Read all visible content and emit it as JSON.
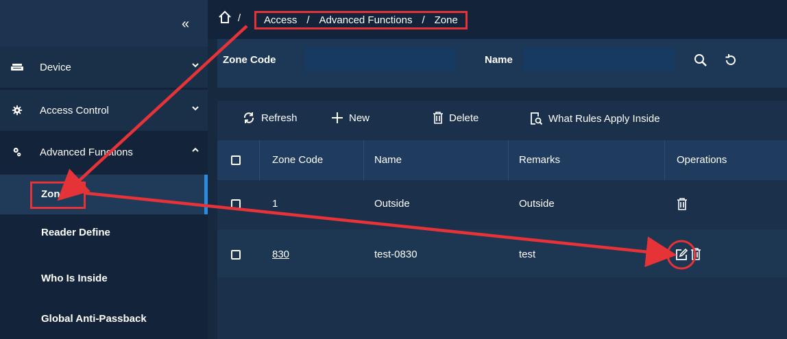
{
  "sidebar": {
    "collapse_glyph": "«",
    "items": [
      {
        "label": "Device",
        "icon": "device-icon",
        "arrow": "⌄"
      },
      {
        "label": "Access Control",
        "icon": "gear-icon",
        "arrow": "⌄"
      },
      {
        "label": "Advanced Functions",
        "icon": "advanced-functions-icon",
        "arrow": "^"
      }
    ],
    "sub_items": [
      {
        "label": "Zone",
        "active": true
      },
      {
        "label": "Reader Define"
      },
      {
        "label": "Who Is Inside"
      },
      {
        "label": "Global Anti-Passback"
      }
    ]
  },
  "breadcrumb": {
    "home_icon": "home-icon",
    "separator": "/",
    "items": [
      "Access",
      "Advanced Functions",
      "Zone"
    ]
  },
  "search": {
    "zone_code_label": "Zone Code",
    "zone_code_value": "",
    "name_label": "Name",
    "name_value": ""
  },
  "toolbar": {
    "refresh_label": "Refresh",
    "new_label": "New",
    "delete_label": "Delete",
    "rules_label": "What Rules Apply Inside"
  },
  "table": {
    "columns": [
      "Zone Code",
      "Name",
      "Remarks",
      "Operations"
    ],
    "rows": [
      {
        "zone_code": "1",
        "name": "Outside",
        "remarks": "Outside",
        "zone_code_link": false
      },
      {
        "zone_code": "830",
        "name": "test-0830",
        "remarks": "test",
        "zone_code_link": true
      }
    ]
  },
  "colors": {
    "annotation_red": "#e63337",
    "accent_blue": "#2a8ce0",
    "sidebar_bg": "#13243a",
    "panel_bg": "#1d3857",
    "header_bg": "#1f3c5f"
  }
}
